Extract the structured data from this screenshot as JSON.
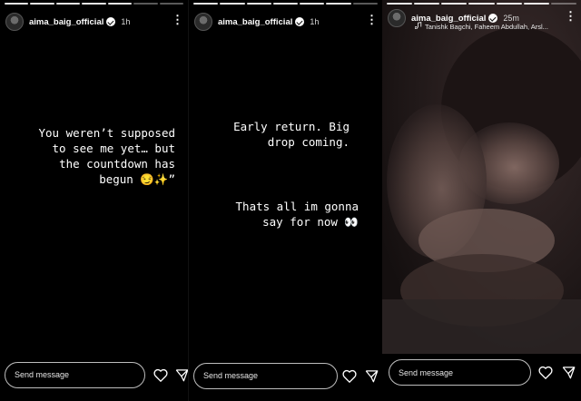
{
  "account": {
    "username": "aima_baig_official"
  },
  "stories": [
    {
      "time": "1h",
      "text": "You weren’t supposed\nto see me yet… but\nthe countdown has\nbegun 😏✨”"
    },
    {
      "time": "1h",
      "text_a": "Early return. Big\ndrop coming.",
      "text_b": "Thats all im gonna\nsay for now 👀"
    },
    {
      "time": "25m",
      "music": "Tanishk Bagchi, Faheem Abdullah, Arsl..."
    }
  ],
  "footer": {
    "placeholder": "Send message"
  },
  "icons": {
    "like": "heart-icon",
    "share": "send-icon",
    "more": "more-options-icon",
    "verified": "verified-badge-icon",
    "music": "music-note-icon"
  },
  "colors": {
    "background": "#000000",
    "text": "#ffffff",
    "border": "#bdbdbd"
  }
}
